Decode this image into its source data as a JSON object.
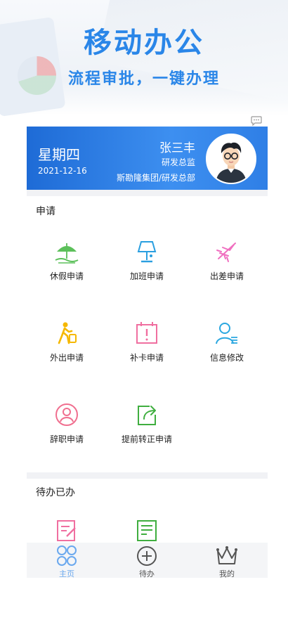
{
  "hero": {
    "title": "移动办公",
    "subtitle": "流程审批，一键办理"
  },
  "card": {
    "weekday": "星期四",
    "date": "2021-12-16",
    "name": "张三丰",
    "position": "研发总监",
    "org": "斯勘隆集团/研发总部"
  },
  "apply": {
    "title": "申请",
    "items": [
      {
        "label": "休假申请",
        "icon": "umbrella-icon",
        "color": "#5cc05a"
      },
      {
        "label": "加班申请",
        "icon": "desk-lamp-icon",
        "color": "#2a9fe0"
      },
      {
        "label": "出差申请",
        "icon": "airplane-icon",
        "color": "#f06fc0"
      },
      {
        "label": "外出申请",
        "icon": "walking-person-icon",
        "color": "#f5b800"
      },
      {
        "label": "补卡申请",
        "icon": "calendar-check-icon",
        "color": "#f06fa0"
      },
      {
        "label": "信息修改",
        "icon": "user-edit-icon",
        "color": "#2aa7e0"
      },
      {
        "label": "辞职申请",
        "icon": "user-circle-icon",
        "color": "#f06f8f"
      },
      {
        "label": "提前转正申请",
        "icon": "share-arrow-icon",
        "color": "#3fae3f"
      }
    ]
  },
  "todo": {
    "title": "待办已办",
    "items": [
      {
        "icon": "todo-edit-icon",
        "color": "#f06fa0"
      },
      {
        "icon": "done-list-icon",
        "color": "#3fae3f"
      }
    ]
  },
  "tabbar": {
    "items": [
      {
        "label": "主页",
        "icon": "home-clover-icon",
        "active": true,
        "color": "#6aa8ee"
      },
      {
        "label": "待办",
        "icon": "plus-circle-icon",
        "active": false,
        "color": "#555555"
      },
      {
        "label": "我的",
        "icon": "crown-icon",
        "active": false,
        "color": "#555555"
      }
    ]
  }
}
